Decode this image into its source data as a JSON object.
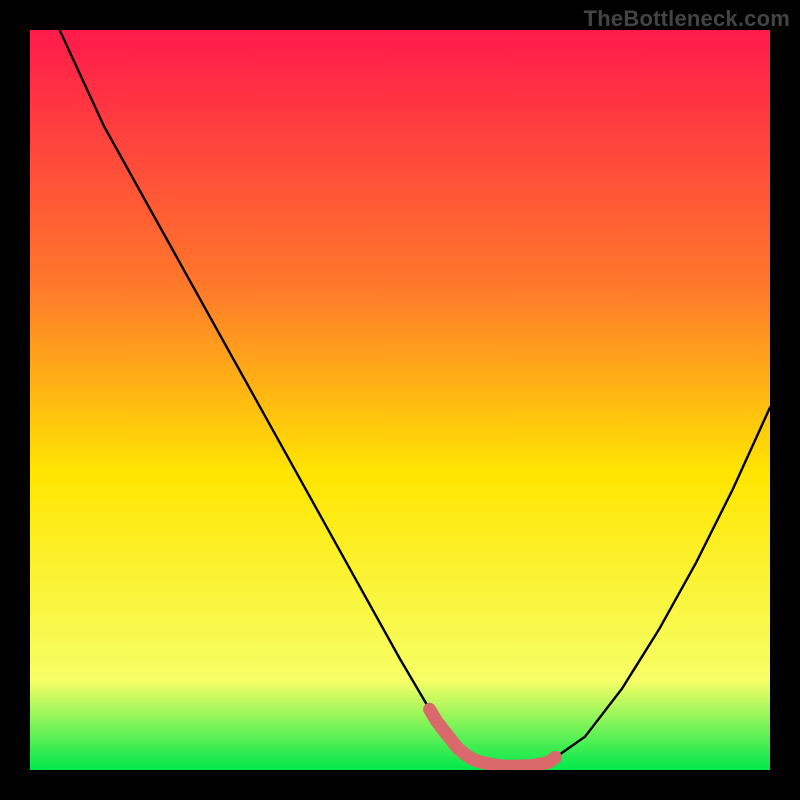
{
  "watermark": "TheBottleneck.com",
  "colors": {
    "background": "#000000",
    "gradient_top": "#ff1a4b",
    "gradient_mid_top": "#ff7a2a",
    "gradient_mid": "#ffe600",
    "gradient_mid_bottom": "#f6ff66",
    "gradient_bottom": "#00e84b",
    "curve": "#000000",
    "marker": "#d9696b"
  },
  "chart_data": {
    "type": "line",
    "title": "",
    "xlabel": "",
    "ylabel": "",
    "xlim": [
      0,
      100
    ],
    "ylim": [
      0,
      100
    ],
    "series": [
      {
        "name": "bottleneck-curve",
        "x": [
          4,
          10,
          20,
          30,
          40,
          45,
          50,
          55,
          58,
          60,
          63,
          65,
          68,
          70,
          75,
          80,
          85,
          90,
          95,
          100
        ],
        "values": [
          100,
          87,
          69,
          51,
          33,
          24,
          15,
          6.5,
          2.7,
          1.3,
          0.6,
          0.5,
          0.6,
          1.0,
          4.5,
          11,
          19,
          28,
          38,
          49
        ]
      }
    ],
    "markers": {
      "name": "highlight-band",
      "x_start": 54,
      "x_end": 71,
      "y_approx": 1
    },
    "annotations": []
  }
}
